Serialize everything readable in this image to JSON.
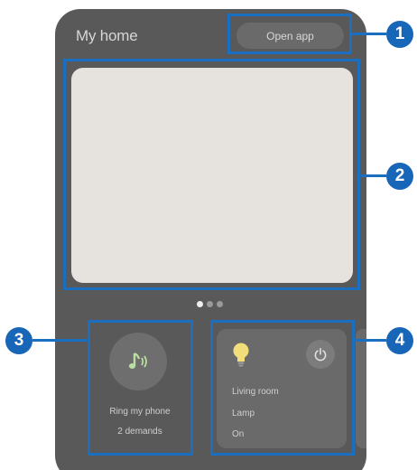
{
  "header": {
    "title": "My home",
    "open_app_label": "Open app"
  },
  "preview_pager": {
    "pages": 3,
    "active_page": 1
  },
  "find_phone_widget": {
    "icon": "music-note-icon",
    "label": "Ring my phone",
    "sublabel": "2 demands"
  },
  "device_card": {
    "device_icon": "lightbulb-icon",
    "power_icon": "power-icon",
    "room": "Living room",
    "device_name": "Lamp",
    "status": "On"
  },
  "callouts": [
    "1",
    "2",
    "3",
    "4"
  ],
  "colors": {
    "callout_blue": "#1766b8",
    "panel": "#595959",
    "preview": "#e6e2de",
    "bulb": "#f1dd7a",
    "music_note": "#b9e0a0"
  }
}
